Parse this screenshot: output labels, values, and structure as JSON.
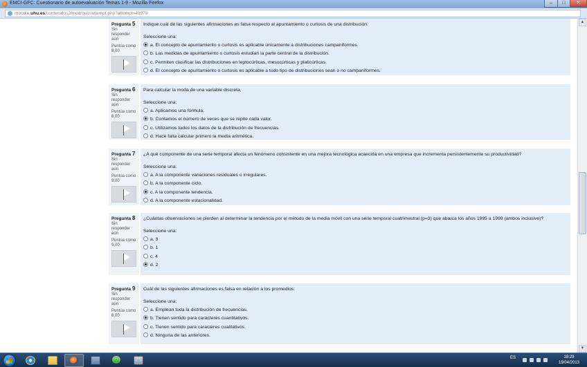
{
  "window": {
    "title": "EMCI-GFC: Cuestionario de autoevaluación Temas 1-9 - Mozilla Firefox",
    "controls": {
      "minimize": "–",
      "maximize": "□",
      "close": "✕"
    }
  },
  "address_bar": {
    "prefix": "moodle.",
    "domain": "uhu.es",
    "path": "/contenidos2/mod/quiz/attempt.php?attempt=49979"
  },
  "questions": [
    {
      "label": "Pregunta",
      "number": "5",
      "state": "Sin responder aún",
      "grade": "Puntúa como 8,00",
      "text": "Indique cuál de las siguientes afirmaciones es falsa respecto al apuntamiento o curtosis de una distribución:",
      "prompt": "Seleccione una:",
      "options": [
        "a. El concepto de apuntamiento o curtosis es aplicable únicamente a distribuciones campaniformes.",
        "b. Las medidas de apuntamiento o curtosis estudian la parte central de la distribución.",
        "c. Permiten clasificar las distribuciones en leptocúrticas, mesocúrticas y platicúrticas.",
        "d. El concepto de apuntamiento o curtosis es aplicable a todo tipo de distribuciones sean o no campaniformes."
      ],
      "selected_index": 0
    },
    {
      "label": "Pregunta",
      "number": "6",
      "state": "Sin responder aún",
      "grade": "Puntúa como 8,00",
      "text": "Para calcular la moda de una variable discreta,",
      "prompt": "Seleccione una:",
      "options": [
        "a. Aplicamos una fórmula.",
        "b. Contamos el número de veces que se repite cada valor.",
        "c. Utilizamos todos los datos de la distribución de frecuencias.",
        "d. Hace falta calcular primero la media aritmética."
      ],
      "selected_index": 1
    },
    {
      "label": "Pregunta",
      "number": "7",
      "state": "Sin responder aún",
      "grade": "Puntúa como 9,00",
      "text": "¿A qué componente de una serie temporal afecta un fenómeno consistente en una mejora tecnológica acaecida en una empresa que incrementa persistentemente su productividad?",
      "prompt": "Seleccione una:",
      "options": [
        "a. A la componente variaciones residuales o irregulares.",
        "b. A la componente ciclo.",
        "c. A la componente tendencia.",
        "d. A la componente estacionalidad."
      ],
      "selected_index": 2
    },
    {
      "label": "Pregunta",
      "number": "8",
      "state": "Sin responder aún",
      "grade": "Puntúa como 9,00",
      "text": "¿Cuántas observaciones se pierden al determinar la tendencia por el método de la media móvil con una serie temporal cuatrimestral (p=3) que abarca los años 1995 a 1999 (ambos inclusive)?",
      "prompt": "Seleccione una:",
      "options": [
        "a. 3",
        "b. 1",
        "c. 4",
        "d. 2"
      ],
      "selected_index": 3
    },
    {
      "label": "Pregunta",
      "number": "9",
      "state": "Sin responder aún",
      "grade": "Puntúa como 8,00",
      "text": "Cuál de las siguientes afirmaciones es falsa en relación a los promedios:",
      "prompt": "Seleccione una:",
      "options": [
        "a. Emplean toda la distribución de frecuencias.",
        "b. Tienen sentido para caracteres cuantitativos.",
        "c. Tienen sentido para caracteres cualitativos.",
        "d. Ninguna de las anteriores."
      ],
      "selected_index": 1
    }
  ],
  "taskbar": {
    "apps": [
      "internet-explorer",
      "file-explorer",
      "firefox",
      "virtualbox",
      "app",
      "tool"
    ],
    "active_app": "firefox",
    "language": "ES",
    "time": "18:29",
    "date": "19/04/2013"
  }
}
